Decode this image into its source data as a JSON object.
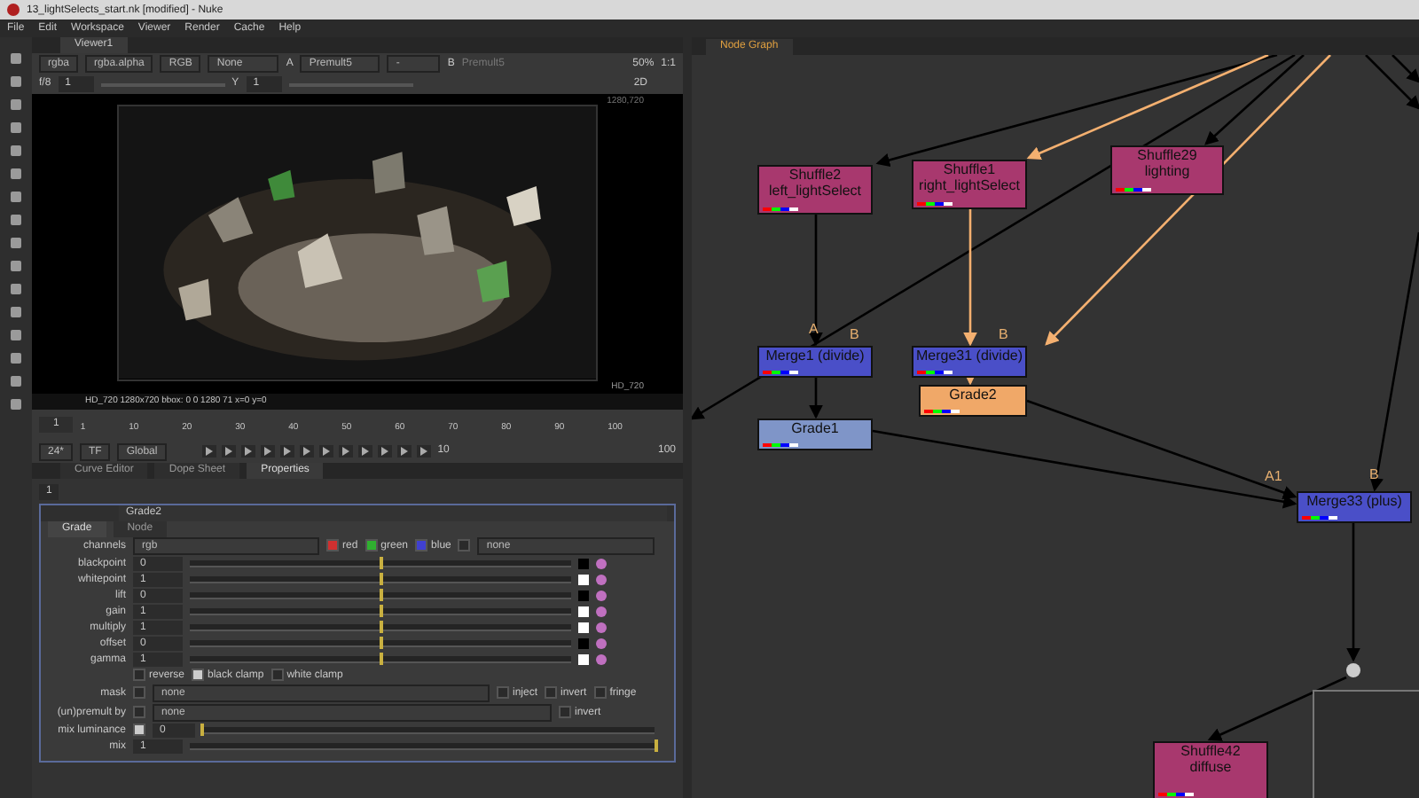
{
  "window": {
    "title": "13_lightSelects_start.nk [modified] - Nuke"
  },
  "menu": [
    "File",
    "Edit",
    "Workspace",
    "Viewer",
    "Render",
    "Cache",
    "Help"
  ],
  "viewer": {
    "tab": "Viewer1",
    "toolbar": [
      "rgba",
      "rgba.alpha",
      "RGB",
      "None",
      "Premult5",
      "-",
      "Premult5"
    ],
    "input_a": "A",
    "input_b": "B",
    "zoom": "50%",
    "ratio": "1:1",
    "frame_field": "f/8",
    "gain": "1",
    "gamma_label": "Y",
    "gamma": "1",
    "mode": "2D",
    "format_corner": "1280,720",
    "format_label": "HD_720",
    "info": "HD_720 1280x720  bbox: 0 0 1280 71  x=0 y=0"
  },
  "timeline": {
    "start": "1",
    "ticks": [
      "1",
      "10",
      "20",
      "30",
      "40",
      "50",
      "60",
      "70",
      "80",
      "90",
      "100"
    ],
    "fps": "24*",
    "tf": "TF",
    "scope": "Global",
    "step": "10",
    "end": "100"
  },
  "bottom_tabs": [
    {
      "label": "Curve Editor",
      "selected": false
    },
    {
      "label": "Dope Sheet",
      "selected": false
    },
    {
      "label": "Properties",
      "selected": true
    }
  ],
  "properties": {
    "count": "1",
    "node_name": "Grade2",
    "tabs": [
      {
        "label": "Grade",
        "selected": true
      },
      {
        "label": "Node",
        "selected": false
      }
    ],
    "channels": {
      "label": "channels",
      "value": "rgb",
      "checks": [
        {
          "label": "red",
          "checked": true,
          "color": "#d03030"
        },
        {
          "label": "green",
          "checked": true,
          "color": "#30b030"
        },
        {
          "label": "blue",
          "checked": true,
          "color": "#4040d0"
        }
      ],
      "extra_checked": false,
      "extra_value": "none"
    },
    "knobs": [
      {
        "label": "blackpoint",
        "value": "0",
        "level": 0.5,
        "color": "#000000"
      },
      {
        "label": "whitepoint",
        "value": "1",
        "level": 0.5,
        "color": "#ffffff"
      },
      {
        "label": "lift",
        "value": "0",
        "level": 0.5,
        "color": "#000000"
      },
      {
        "label": "gain",
        "value": "1",
        "level": 0.5,
        "color": "#ffffff"
      },
      {
        "label": "multiply",
        "value": "1",
        "level": 0.5,
        "color": "#ffffff"
      },
      {
        "label": "offset",
        "value": "0",
        "level": 0.5,
        "color": "#000000"
      },
      {
        "label": "gamma",
        "value": "1",
        "level": 0.5,
        "color": "#ffffff"
      }
    ],
    "clamps": [
      {
        "label": "reverse",
        "checked": false
      },
      {
        "label": "black clamp",
        "checked": true
      },
      {
        "label": "white clamp",
        "checked": false
      }
    ],
    "mask": {
      "label": "mask",
      "checked": false,
      "value": "none",
      "options": [
        {
          "label": "inject",
          "checked": false
        },
        {
          "label": "invert",
          "checked": false
        },
        {
          "label": "fringe",
          "checked": false
        }
      ]
    },
    "premult": {
      "label": "(un)premult by",
      "checked": false,
      "value": "none",
      "options": [
        {
          "label": "invert",
          "checked": false
        }
      ]
    },
    "mix_luminance": {
      "label": "mix luminance",
      "checked": true,
      "value": "0",
      "level": 0
    },
    "mix": {
      "label": "mix",
      "value": "1",
      "level": 1
    }
  },
  "node_graph": {
    "tab": "Node Graph",
    "nodes": [
      {
        "kind": "shuffle",
        "title": "Shuffle2",
        "subtitle": "left_lightSelect",
        "selected": false
      },
      {
        "kind": "shuffle",
        "title": "Shuffle1",
        "subtitle": "right_lightSelect",
        "selected": false
      },
      {
        "kind": "shuffle",
        "title": "Shuffle29",
        "subtitle": "lighting",
        "selected": false
      },
      {
        "kind": "merge",
        "title": "Merge1 (divide)",
        "selected": false
      },
      {
        "kind": "merge",
        "title": "Merge31 (divide)",
        "selected": false
      },
      {
        "kind": "grade",
        "title": "Grade2",
        "selected": true
      },
      {
        "kind": "grade",
        "title": "Grade1",
        "selected": false
      },
      {
        "kind": "merge",
        "title": "Merge33 (plus)",
        "selected": false
      },
      {
        "kind": "shuffle",
        "title": "Shuffle42",
        "subtitle": "diffuse",
        "selected": false
      }
    ],
    "input_labels": [
      "A",
      "B",
      "B",
      "A1",
      "B"
    ]
  }
}
